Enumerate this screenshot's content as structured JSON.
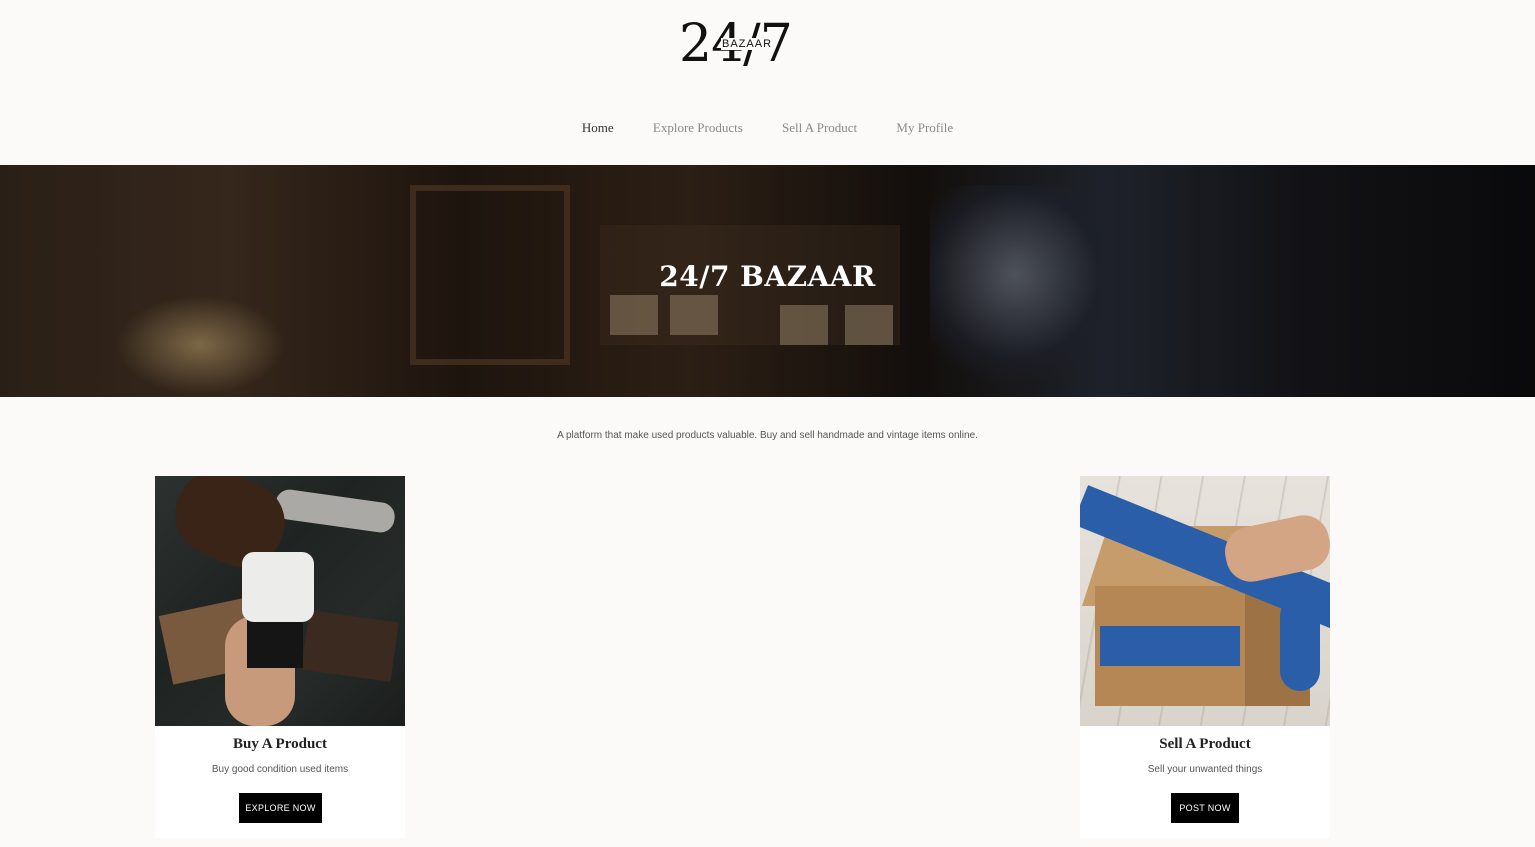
{
  "logo": {
    "number": "24/7",
    "word": "BAZAAR"
  },
  "nav": {
    "items": [
      {
        "label": "Home"
      },
      {
        "label": "Explore Products"
      },
      {
        "label": "Sell A Product"
      },
      {
        "label": "My Profile"
      }
    ],
    "active": "Home"
  },
  "hero": {
    "title": "24/7 BAZAAR"
  },
  "tagline": "A platform that make used products valuable. Buy and sell handmade and vintage items online.",
  "cards": {
    "buy": {
      "title": "Buy A Product",
      "description": "Buy good condition used items",
      "button_label": "EXPLORE NOW"
    },
    "sell": {
      "title": "Sell A Product",
      "description": "Sell your unwanted things",
      "button_label": "POST NOW"
    }
  },
  "colors": {
    "background": "#fcfaf8",
    "button": "#000000",
    "nav_active": "#333333",
    "nav_inactive": "#8a8a8a"
  }
}
